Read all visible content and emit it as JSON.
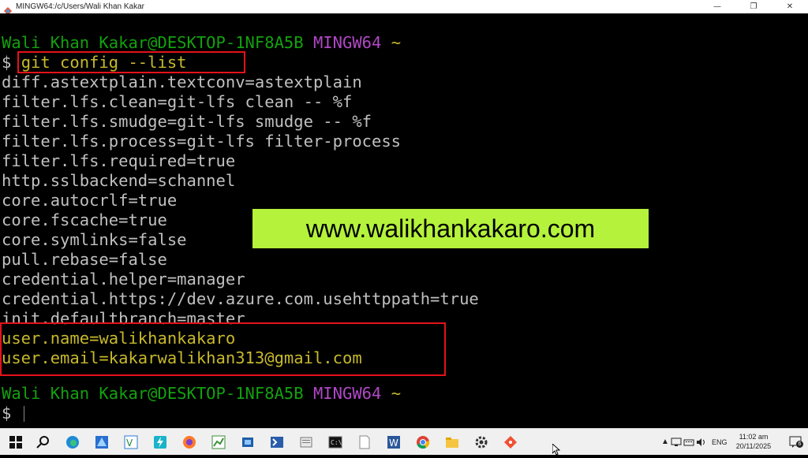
{
  "window": {
    "title": "MINGW64:/c/Users/Wali Khan Kakar",
    "controls": {
      "minimize": "—",
      "maximize": "❐",
      "close": "✕"
    }
  },
  "terminal": {
    "prompt1": {
      "user": "Wali Khan Kakar@DESKTOP-1NF8A5B",
      "env": "MINGW64",
      "dir": "~"
    },
    "command": {
      "symbol": "$",
      "text": "git config --list"
    },
    "output": [
      "diff.astextplain.textconv=astextplain",
      "filter.lfs.clean=git-lfs clean -- %f",
      "filter.lfs.smudge=git-lfs smudge -- %f",
      "filter.lfs.process=git-lfs filter-process",
      "filter.lfs.required=true",
      "http.sslbackend=schannel",
      "core.autocrlf=true",
      "core.fscache=true",
      "core.symlinks=false",
      "pull.rebase=false",
      "credential.helper=manager",
      "credential.https://dev.azure.com.usehttppath=true",
      "init.defaultbranch=master"
    ],
    "user_lines": [
      "user.name=walikhankakaro",
      "user.email=kakarwalikhan313@gmail.com"
    ],
    "prompt2": {
      "user": "Wali Khan Kakar@DESKTOP-1NF8A5B",
      "env": "MINGW64",
      "dir": "~"
    },
    "final_symbol": "$",
    "colors": {
      "background": "#000000",
      "text": "#c0c0c0",
      "user": "#13a10e",
      "env": "#b148c6",
      "dir": "#c7b92b",
      "highlight": "#e5121b"
    }
  },
  "banner": {
    "text": "www.walikhankakaro.com",
    "color": "#b5f23c"
  },
  "taskbar": {
    "icons": [
      "windows-icon",
      "search-icon",
      "edge-icon",
      "azure-data-studio-icon",
      "vscode-icon",
      "power-automate-icon",
      "firefox-icon",
      "excel-tool-icon",
      "virtualbox-icon",
      "powershell-icon",
      "notepad-plus-icon",
      "cmd-icon",
      "file-icon",
      "word-icon",
      "chrome-icon",
      "file-explorer-icon",
      "settings-icon",
      "git-icon"
    ],
    "language": "ENG",
    "time": "11:02 am",
    "date": "20/11/2025",
    "notifications": "6"
  }
}
